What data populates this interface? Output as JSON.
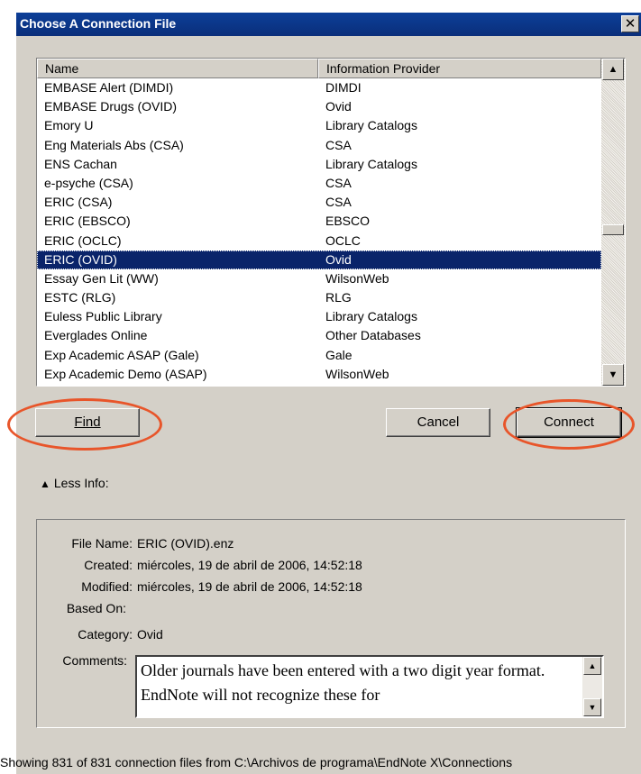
{
  "window": {
    "title": "Choose A Connection File",
    "close_label": "✕"
  },
  "list": {
    "columns": [
      "Name",
      "Information Provider"
    ],
    "rows": [
      {
        "name": "EMBASE Alert (DIMDI)",
        "provider": "DIMDI"
      },
      {
        "name": "EMBASE Drugs (OVID)",
        "provider": "Ovid"
      },
      {
        "name": "Emory U",
        "provider": "Library Catalogs"
      },
      {
        "name": "Eng Materials Abs (CSA)",
        "provider": "CSA"
      },
      {
        "name": "ENS Cachan",
        "provider": "Library Catalogs"
      },
      {
        "name": "e-psyche (CSA)",
        "provider": "CSA"
      },
      {
        "name": "ERIC (CSA)",
        "provider": "CSA"
      },
      {
        "name": "ERIC (EBSCO)",
        "provider": "EBSCO"
      },
      {
        "name": "ERIC (OCLC)",
        "provider": "OCLC"
      },
      {
        "name": "ERIC (OVID)",
        "provider": "Ovid",
        "selected": true
      },
      {
        "name": "Essay Gen Lit (WW)",
        "provider": "WilsonWeb"
      },
      {
        "name": "ESTC (RLG)",
        "provider": "RLG"
      },
      {
        "name": "Euless Public Library",
        "provider": "Library Catalogs"
      },
      {
        "name": "Everglades Online",
        "provider": "Other Databases"
      },
      {
        "name": "Exp Academic ASAP (Gale)",
        "provider": "Gale"
      },
      {
        "name": "Exp Academic Demo (ASAP)",
        "provider": "WilsonWeb"
      }
    ]
  },
  "buttons": {
    "find": "Find",
    "cancel": "Cancel",
    "connect": "Connect"
  },
  "less_info": "Less Info:",
  "details": {
    "file_name_label": "File Name:",
    "file_name": "ERIC (OVID).enz",
    "created_label": "Created:",
    "created": "miércoles, 19 de abril de 2006, 14:52:18",
    "modified_label": "Modified:",
    "modified": "miércoles, 19 de abril de 2006, 14:52:18",
    "based_on_label": "Based On:",
    "based_on": "",
    "category_label": "Category:",
    "category": "Ovid",
    "comments_label": "Comments:",
    "comments": "Older journals have been entered with a two digit year format. EndNote will not recognize these for"
  },
  "status": "Showing 831 of 831 connection files from C:\\Archivos de programa\\EndNote X\\Connections",
  "colors": {
    "selection": "#0a246a",
    "title_bar": "#0a2e7a",
    "highlight_oval": "#e8552a",
    "dialog": "#d4d0c8"
  }
}
